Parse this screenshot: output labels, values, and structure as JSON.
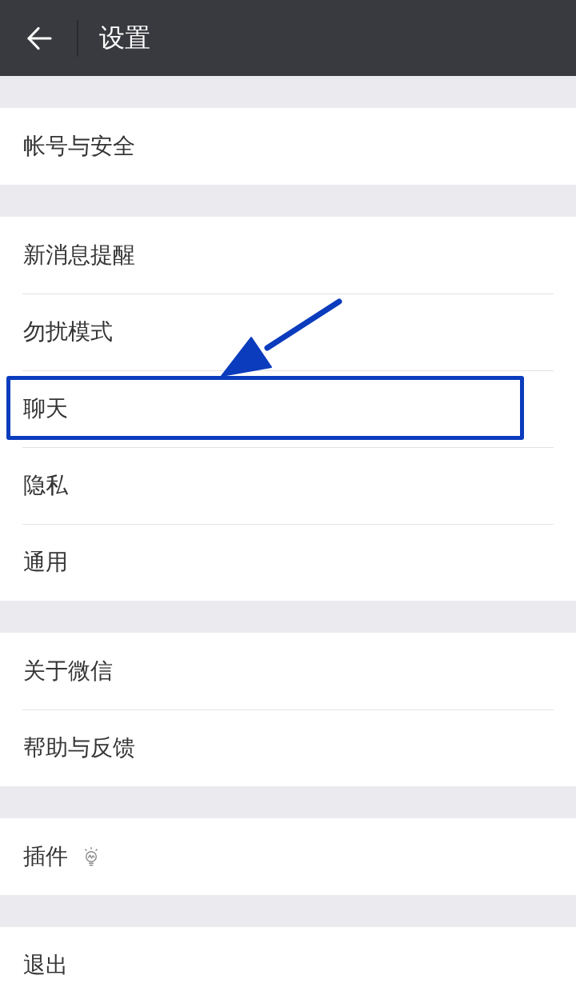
{
  "top_bar": {
    "title": "设置"
  },
  "groups": [
    {
      "items": [
        {
          "label": "帐号与安全",
          "kind": "plain",
          "highlighted": false
        }
      ]
    },
    {
      "items": [
        {
          "label": "新消息提醒",
          "kind": "plain",
          "highlighted": false
        },
        {
          "label": "勿扰模式",
          "kind": "plain",
          "highlighted": false
        },
        {
          "label": "聊天",
          "kind": "plain",
          "highlighted": true
        },
        {
          "label": "隐私",
          "kind": "plain",
          "highlighted": false
        },
        {
          "label": "通用",
          "kind": "plain",
          "highlighted": false
        }
      ]
    },
    {
      "items": [
        {
          "label": "关于微信",
          "kind": "plain",
          "highlighted": false
        },
        {
          "label": "帮助与反馈",
          "kind": "plain",
          "highlighted": false
        }
      ]
    },
    {
      "items": [
        {
          "label": "插件",
          "kind": "with-icon",
          "highlighted": false
        }
      ]
    },
    {
      "items": [
        {
          "label": "退出",
          "kind": "plain",
          "highlighted": false
        }
      ]
    }
  ]
}
